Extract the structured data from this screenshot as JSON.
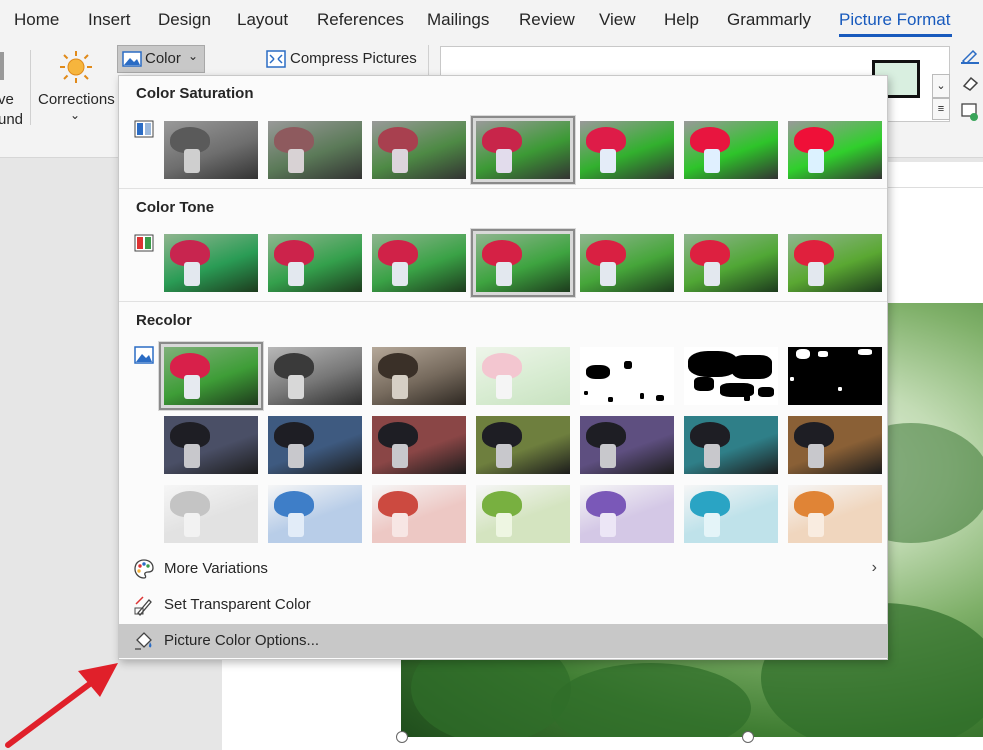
{
  "tabs": [
    "Home",
    "Insert",
    "Design",
    "Layout",
    "References",
    "Mailings",
    "Review",
    "View",
    "Help",
    "Grammarly",
    "Picture Format"
  ],
  "active_tab": "Picture Format",
  "ribbon": {
    "remove_bg_partial_1": "ve",
    "remove_bg_partial_2": "und",
    "corrections": "Corrections",
    "color": "Color",
    "compress": "Compress Pictures"
  },
  "menu": {
    "saturation_title": "Color Saturation",
    "tone_title": "Color Tone",
    "recolor_title": "Recolor",
    "more_variations": "More Variations",
    "set_transparent": "Set Transparent Color",
    "picture_color_options": "Picture Color Options..."
  },
  "colors": {
    "accent": "#185abd",
    "arrow": "#e0202a",
    "hover": "#c8c8c8"
  },
  "icons": [
    "sun-icon",
    "color-icon",
    "compress-icon",
    "palette-icon",
    "eyedropper-pen-icon",
    "paintbucket-icon",
    "chevron-right-icon"
  ]
}
